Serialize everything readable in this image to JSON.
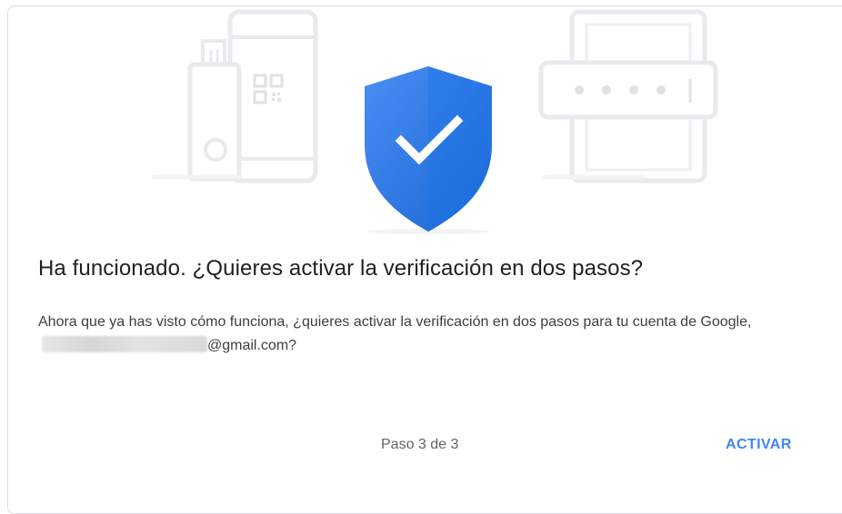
{
  "dialog": {
    "title": "Ha funcionado. ¿Quieres activar la verificación en dos pasos?",
    "body_prefix": "Ahora que ya has visto cómo funciona, ¿quieres activar la verificación en dos pasos para tu cuenta de Google,",
    "body_suffix": "@gmail.com?",
    "step_text": "Paso 3 de 3",
    "activate_label": "ACTIVAR"
  },
  "illustration": {
    "icons": [
      "security-key-icon",
      "phone-icon",
      "shield-check-icon",
      "tablet-password-icon"
    ],
    "shield_color": "#1a73e8",
    "shield_highlight_color": "#4285f4",
    "device_outline_color": "#e8eaed"
  },
  "colors": {
    "accent": "#4285f4",
    "title_text": "#202124",
    "body_text": "#3c4043",
    "secondary_text": "#5f6368"
  }
}
